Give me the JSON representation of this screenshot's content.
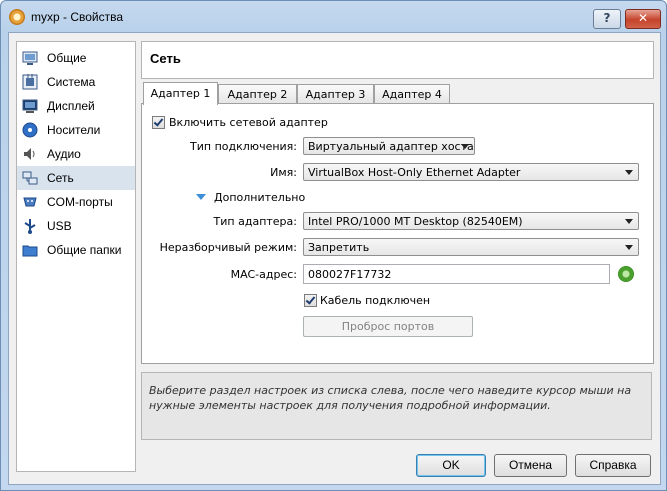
{
  "window": {
    "title": "myxp - Свойства",
    "help_glyph": "?",
    "close_glyph": "✕"
  },
  "sidebar": {
    "items": [
      {
        "label": "Общие",
        "icon": "general-icon"
      },
      {
        "label": "Система",
        "icon": "system-icon"
      },
      {
        "label": "Дисплей",
        "icon": "display-icon"
      },
      {
        "label": "Носители",
        "icon": "storage-icon"
      },
      {
        "label": "Аудио",
        "icon": "audio-icon"
      },
      {
        "label": "Сеть",
        "icon": "network-icon",
        "selected": true
      },
      {
        "label": "COM-порты",
        "icon": "serial-ports-icon"
      },
      {
        "label": "USB",
        "icon": "usb-icon"
      },
      {
        "label": "Общие папки",
        "icon": "shared-folders-icon"
      }
    ]
  },
  "header": {
    "title": "Сеть"
  },
  "tabs": [
    {
      "label": "Адаптер 1",
      "active": true
    },
    {
      "label": "Адаптер 2"
    },
    {
      "label": "Адаптер 3"
    },
    {
      "label": "Адаптер 4"
    }
  ],
  "adapter": {
    "enable_label": "Включить сетевой адаптер",
    "attached_label": "Тип подключения:",
    "attached_value": "Виртуальный адаптер хоста",
    "name_label": "Имя:",
    "name_value": "VirtualBox Host-Only Ethernet Adapter",
    "advanced_label": "Дополнительно",
    "adapter_type_label": "Тип адаптера:",
    "adapter_type_value": "Intel PRO/1000 MT Desktop (82540EM)",
    "promisc_label": "Неразборчивый режим:",
    "promisc_value": "Запретить",
    "mac_label": "MAC-адрес:",
    "mac_value": "080027F17732",
    "cable_label": "Кабель подключен",
    "port_forwarding_label": "Проброс портов"
  },
  "info_text": "Выберите раздел настроек из списка слева, после чего наведите курсор мыши на нужные элементы настроек для получения подробной информации.",
  "buttons": {
    "ok": "OK",
    "cancel": "Отмена",
    "help": "Справка"
  }
}
